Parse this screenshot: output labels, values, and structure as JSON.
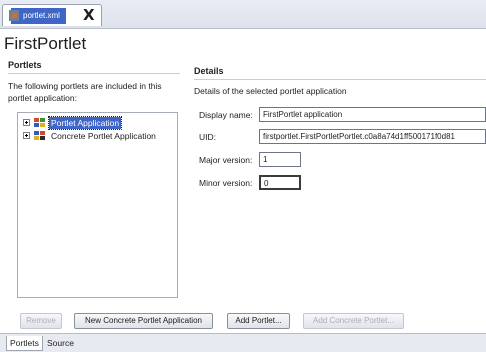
{
  "editor_tab": {
    "label": "portlet.xml",
    "close_glyph": "X"
  },
  "form_title": "FirstPortlet",
  "left_panel": {
    "heading": "Portlets",
    "intro": "The following portlets are included in this portlet application:",
    "tree": [
      {
        "label": "Portlet Application",
        "icon": "portlet-application-icon",
        "selected": true
      },
      {
        "label": "Concrete Portlet Application",
        "icon": "concrete-portlet-icon",
        "selected": false
      }
    ]
  },
  "details": {
    "heading": "Details",
    "description": "Details of the selected portlet application",
    "fields": {
      "display_name": {
        "label": "Display name:",
        "value": "FirstPortlet application"
      },
      "uid": {
        "label": "UID:",
        "value": "firstportlet.FirstPortletPortlet.c0a8a74d1ff500171f0d81"
      },
      "major_version": {
        "label": "Major version:",
        "value": "1"
      },
      "minor_version": {
        "label": "Minor version:",
        "value": "0"
      }
    }
  },
  "buttons": {
    "remove": "Remove",
    "new_concrete": "New Concrete Portlet Application",
    "add_portlet": "Add Portlet...",
    "add_concrete": "Add Concrete Portlet..."
  },
  "bottom_tabs": [
    "Portlets",
    "Source"
  ],
  "colors": {
    "selection": "#3f66c7",
    "tab_highlight": "#3f66c7"
  }
}
